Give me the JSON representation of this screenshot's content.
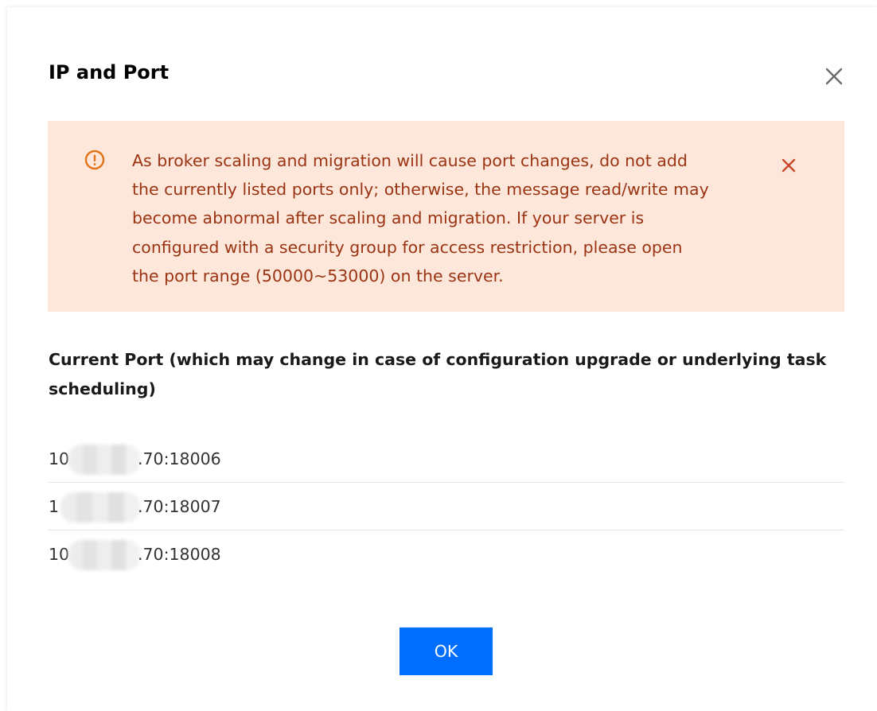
{
  "dialog": {
    "title": "IP and Port"
  },
  "alert": {
    "message": "As broker scaling and migration will cause port changes, do not add the currently listed ports only; otherwise, the message read/write may become abnormal after scaling and migration. If your server is configured with a security group for access restriction, please open the port range (50000~53000) on the server.",
    "icon": "warning-circle-icon",
    "close_icon": "close-icon",
    "text_color": "#9a3413",
    "background": "#fde7da",
    "icon_color": "#e37318"
  },
  "ports": {
    "label": "Current Port (which may change in case of configuration upgrade or underlying task scheduling)",
    "rows": [
      {
        "prefix": "10",
        "suffix": ".70:18006"
      },
      {
        "prefix": "1",
        "suffix": ".70:18007"
      },
      {
        "prefix": "10",
        "suffix": ".70:18008"
      }
    ]
  },
  "footer": {
    "ok_label": "OK",
    "ok_color": "#006eff"
  }
}
